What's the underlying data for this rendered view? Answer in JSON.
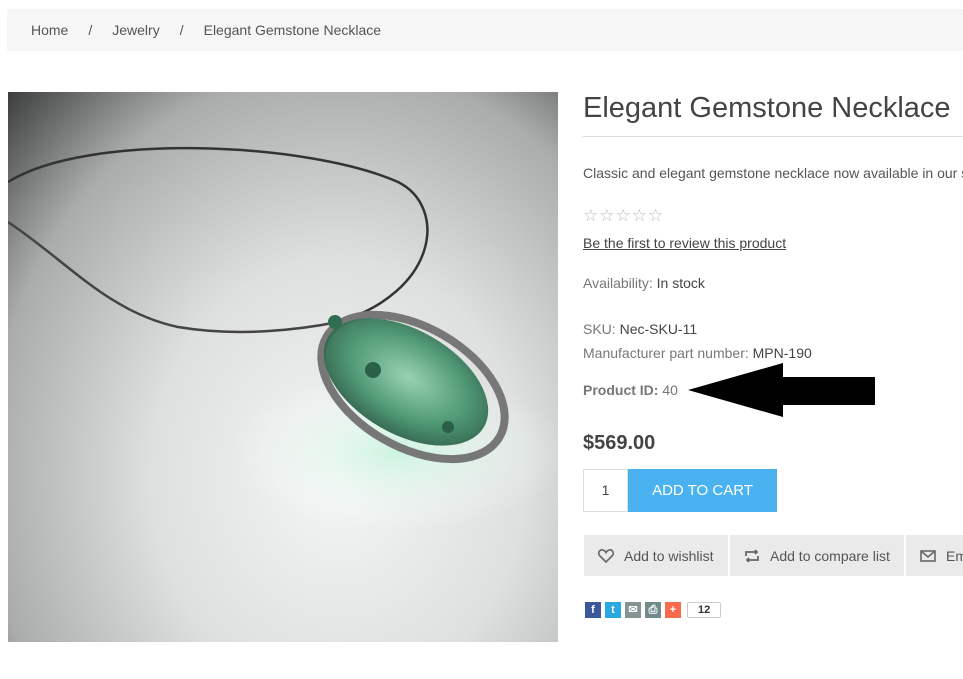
{
  "breadcrumb": {
    "items": [
      "Home",
      "Jewelry",
      "Elegant Gemstone Necklace"
    ],
    "separator": "/"
  },
  "product": {
    "title": "Elegant Gemstone Necklace",
    "short_description": "Classic and elegant gemstone necklace now available in our s",
    "rating_stars": 0,
    "rating_max": 5,
    "review_link": "Be the first to review this product",
    "availability_label": "Availability:",
    "availability_value": "In stock",
    "sku_label": "SKU:",
    "sku_value": "Nec-SKU-11",
    "mpn_label": "Manufacturer part number:",
    "mpn_value": "MPN-190",
    "id_label": "Product ID:",
    "id_value": "40",
    "price": "$569.00",
    "quantity": "1",
    "add_to_cart": "ADD TO CART",
    "wishlist": "Add to wishlist",
    "compare": "Add to compare list",
    "email": "Em",
    "share_count": "12"
  },
  "colors": {
    "accent": "#4ab2f1",
    "facebook": "#3b5998",
    "twitter": "#29a9e1",
    "email": "#849493",
    "print": "#738a8d",
    "more": "#f8694d"
  }
}
